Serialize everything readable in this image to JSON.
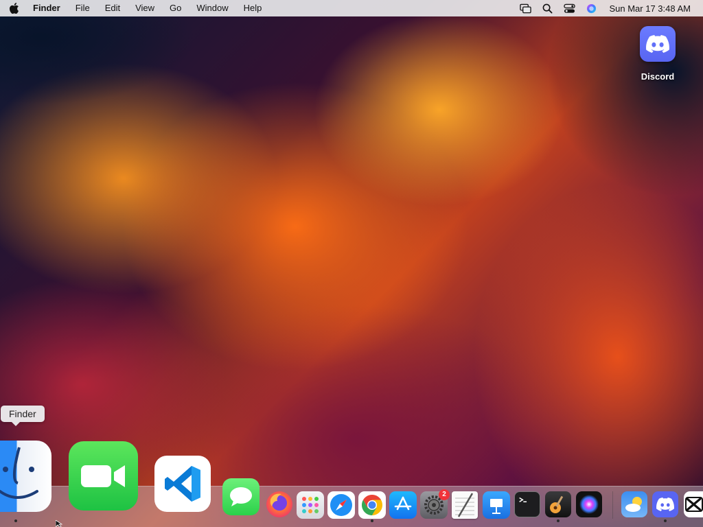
{
  "menubar": {
    "app_name": "Finder",
    "items": [
      "File",
      "Edit",
      "View",
      "Go",
      "Window",
      "Help"
    ],
    "clock": "Sun Mar 17  3:48 AM",
    "status_icons": [
      "screen-mirroring-icon",
      "spotlight-search-icon",
      "control-center-icon",
      "siri-icon"
    ]
  },
  "desktop": {
    "icons": [
      {
        "label": "Discord",
        "icon": "discord-icon"
      }
    ]
  },
  "tooltip": {
    "text": "Finder"
  },
  "dock": {
    "items": [
      {
        "name": "Finder",
        "running": true
      },
      {
        "name": "FaceTime",
        "running": false
      },
      {
        "name": "Visual Studio Code",
        "running": false
      },
      {
        "name": "Messages",
        "running": false
      },
      {
        "name": "Firefox",
        "running": false
      },
      {
        "name": "Launchpad",
        "running": false
      },
      {
        "name": "Safari",
        "running": false
      },
      {
        "name": "Google Chrome",
        "running": true
      },
      {
        "name": "App Store",
        "running": false
      },
      {
        "name": "System Settings",
        "running": false,
        "badge": "2"
      },
      {
        "name": "TextEdit",
        "running": false
      },
      {
        "name": "Keynote",
        "running": false
      },
      {
        "name": "Terminal",
        "running": false
      },
      {
        "name": "GarageBand",
        "running": true
      },
      {
        "name": "Siri",
        "running": false
      },
      {
        "name": "Weather",
        "running": false
      },
      {
        "name": "Discord",
        "running": true
      },
      {
        "name": "CapCut",
        "running": false
      }
    ]
  },
  "colors": {
    "menubar_bg": "#e8e8ea",
    "discord": "#5865f2",
    "facetime": "#2fd158",
    "vscode": "#0a7bd6",
    "badge": "#f0333a"
  }
}
